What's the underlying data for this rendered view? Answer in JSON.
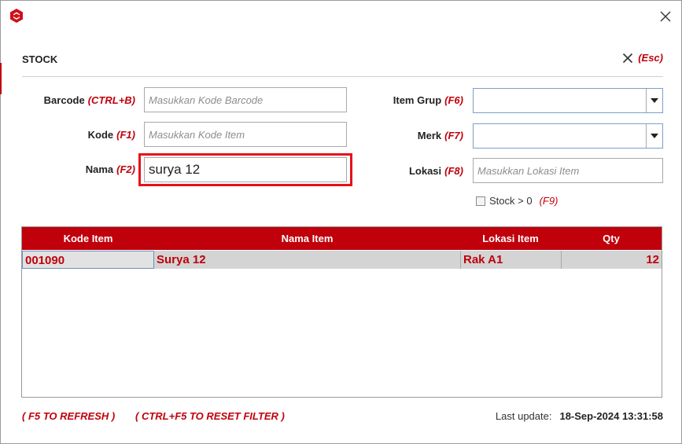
{
  "window": {
    "title": "STOCK",
    "close_label": "(Esc)"
  },
  "form": {
    "barcode": {
      "label": "Barcode",
      "shortcut": "(CTRL+B)",
      "placeholder": "Masukkan Kode Barcode",
      "value": ""
    },
    "kode": {
      "label": "Kode",
      "shortcut": "(F1)",
      "placeholder": "Masukkan Kode Item",
      "value": ""
    },
    "nama": {
      "label": "Nama",
      "shortcut": "(F2)",
      "value": "surya 12"
    },
    "item_grup": {
      "label": "Item Grup",
      "shortcut": "(F6)",
      "value": ""
    },
    "merk": {
      "label": "Merk",
      "shortcut": "(F7)",
      "value": ""
    },
    "lokasi": {
      "label": "Lokasi",
      "shortcut": "(F8)",
      "placeholder": "Masukkan Lokasi Item",
      "value": ""
    },
    "stock_filter": {
      "label": "Stock > 0",
      "shortcut": "(F9)",
      "checked": false
    }
  },
  "table": {
    "columns": [
      "Kode Item",
      "Nama Item",
      "Lokasi Item",
      "Qty"
    ],
    "rows": [
      {
        "kode": "001090",
        "nama": "Surya 12",
        "lokasi": "Rak A1",
        "qty": "12"
      }
    ]
  },
  "footer": {
    "refresh_hint": "( F5 TO REFRESH )",
    "reset_hint": "( CTRL+F5 TO RESET FILTER )",
    "last_update_label": "Last update:",
    "last_update_value": "18-Sep-2024 13:31:58"
  },
  "colors": {
    "accent": "#c0000b",
    "highlight_border": "#e8101a",
    "row_bg": "#d4d4d4"
  },
  "icons": {
    "app": "app-logo-icon",
    "close": "close-icon",
    "dropdown": "chevron-down-icon"
  }
}
